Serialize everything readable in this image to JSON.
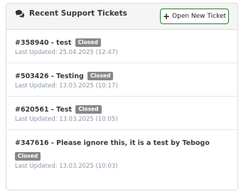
{
  "panel": {
    "title": "Recent Support Tickets",
    "icon": "comments-icon",
    "open_button_label": "Open New Ticket"
  },
  "tickets": [
    {
      "id_title": "#358940 - test",
      "status": "Closed",
      "updated": "Last Updated: 25.04.2025 (12:47)"
    },
    {
      "id_title": "#503426 - Testing",
      "status": "Closed",
      "updated": "Last Updated: 13.03.2025 (10:17)"
    },
    {
      "id_title": "#620561 - Test",
      "status": "Closed",
      "updated": "Last Updated: 13.03.2025 (10:05)"
    },
    {
      "id_title": "#347616 - Please ignore this, it is a test by Tebogo",
      "status": "Closed",
      "updated": "Last Updated: 13.03.2025 (10:03)"
    }
  ],
  "colors": {
    "badge": "#888888",
    "button_border": "#2e7d32",
    "date_text": "#8c97a8"
  }
}
